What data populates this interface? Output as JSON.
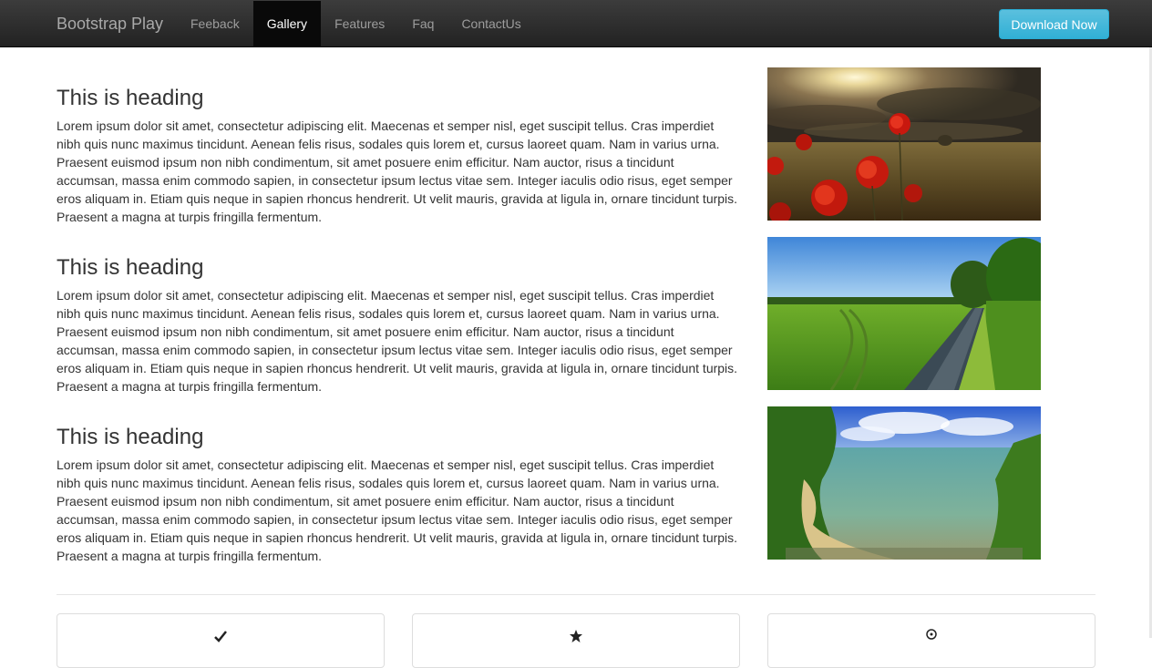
{
  "navbar": {
    "brand": "Bootstrap Play",
    "items": [
      {
        "label": "Feeback",
        "active": false
      },
      {
        "label": "Gallery",
        "active": true
      },
      {
        "label": "Features",
        "active": false
      },
      {
        "label": "Faq",
        "active": false
      },
      {
        "label": "ContactUs",
        "active": false
      }
    ],
    "cta_label": "Download Now"
  },
  "sections": [
    {
      "heading": "This is heading",
      "body": "Lorem ipsum dolor sit amet, consectetur adipiscing elit. Maecenas et semper nisl, eget suscipit tellus. Cras imperdiet nibh quis nunc maximus tincidunt. Aenean felis risus, sodales quis lorem et, cursus laoreet quam. Nam in varius urna. Praesent euismod ipsum non nibh condimentum, sit amet posuere enim efficitur. Nam auctor, risus a tincidunt accumsan, massa enim commodo sapien, in consectetur ipsum lectus vitae sem. Integer iaculis odio risus, eget semper eros aliquam in. Etiam quis neque in sapien rhoncus hendrerit. Ut velit mauris, gravida at ligula in, ornare tincidunt turpis. Praesent a magna at turpis fringilla fermentum.",
      "image": "poppy-field-sunset"
    },
    {
      "heading": "This is heading",
      "body": "Lorem ipsum dolor sit amet, consectetur adipiscing elit. Maecenas et semper nisl, eget suscipit tellus. Cras imperdiet nibh quis nunc maximus tincidunt. Aenean felis risus, sodales quis lorem et, cursus laoreet quam. Nam in varius urna. Praesent euismod ipsum non nibh condimentum, sit amet posuere enim efficitur. Nam auctor, risus a tincidunt accumsan, massa enim commodo sapien, in consectetur ipsum lectus vitae sem. Integer iaculis odio risus, eget semper eros aliquam in. Etiam quis neque in sapien rhoncus hendrerit. Ut velit mauris, gravida at ligula in, ornare tincidunt turpis. Praesent a magna at turpis fringilla fermentum.",
      "image": "green-field-road"
    },
    {
      "heading": "This is heading",
      "body": "Lorem ipsum dolor sit amet, consectetur adipiscing elit. Maecenas et semper nisl, eget suscipit tellus. Cras imperdiet nibh quis nunc maximus tincidunt. Aenean felis risus, sodales quis lorem et, cursus laoreet quam. Nam in varius urna. Praesent euismod ipsum non nibh condimentum, sit amet posuere enim efficitur. Nam auctor, risus a tincidunt accumsan, massa enim commodo sapien, in consectetur ipsum lectus vitae sem. Integer iaculis odio risus, eget semper eros aliquam in. Etiam quis neque in sapien rhoncus hendrerit. Ut velit mauris, gravida at ligula in, ornare tincidunt turpis. Praesent a magna at turpis fringilla fermentum.",
      "image": "tropical-beach-lagoon"
    }
  ],
  "features": [
    {
      "icon": "checkmark-icon"
    },
    {
      "icon": "star-icon"
    },
    {
      "icon": "map-pin-icon"
    }
  ],
  "colors": {
    "navbar_bg": "#222222",
    "nav_active_bg": "#090909",
    "cta_bg": "#5bc0de",
    "text": "#333333"
  }
}
